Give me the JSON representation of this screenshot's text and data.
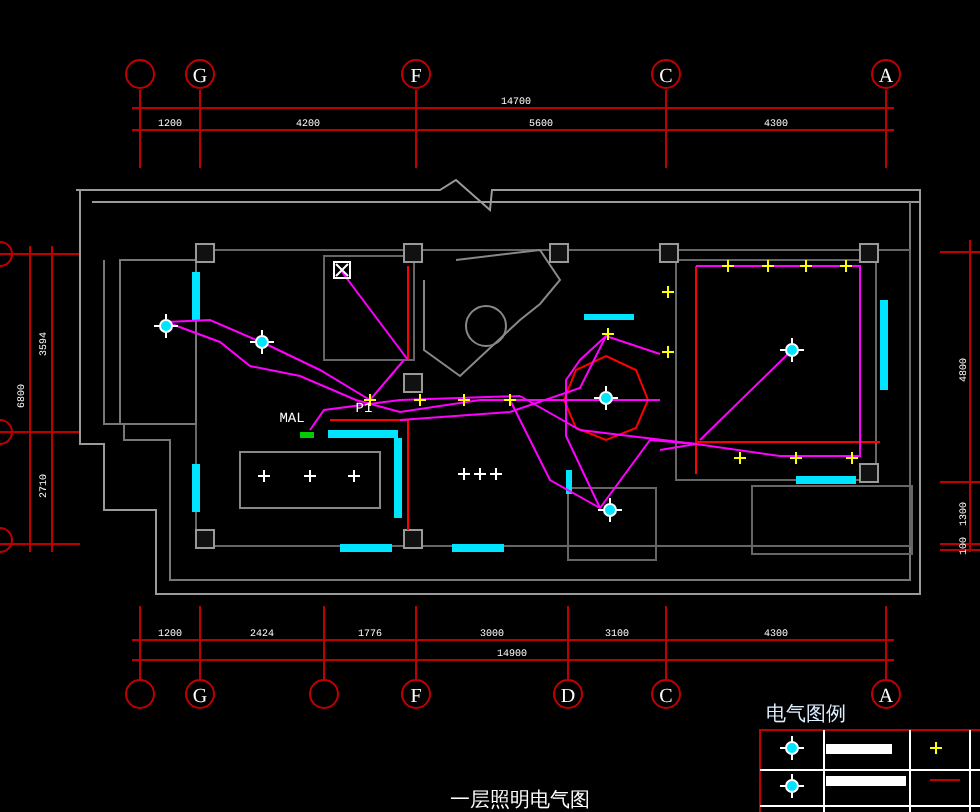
{
  "top_axis": {
    "bubbles": [
      "G",
      "F",
      "C",
      "A"
    ],
    "total": "14700",
    "spans": [
      "1200",
      "4200",
      "5600",
      "4300"
    ]
  },
  "bottom_axis": {
    "bubbles": [
      "G",
      "F",
      "D",
      "C",
      "A"
    ],
    "total": "14900",
    "spans": [
      "1200",
      "2424",
      "1776",
      "3000",
      "3100",
      "4300"
    ]
  },
  "left_dimensions": {
    "total": "6800",
    "spans": [
      "3594",
      "2710"
    ]
  },
  "right_dimensions": {
    "spans": [
      "4800",
      "1300",
      "100"
    ]
  },
  "plan_labels": [
    "MAL",
    "P1"
  ],
  "legend": {
    "title": "电气图例"
  },
  "drawing_title": "一层照明电气图"
}
